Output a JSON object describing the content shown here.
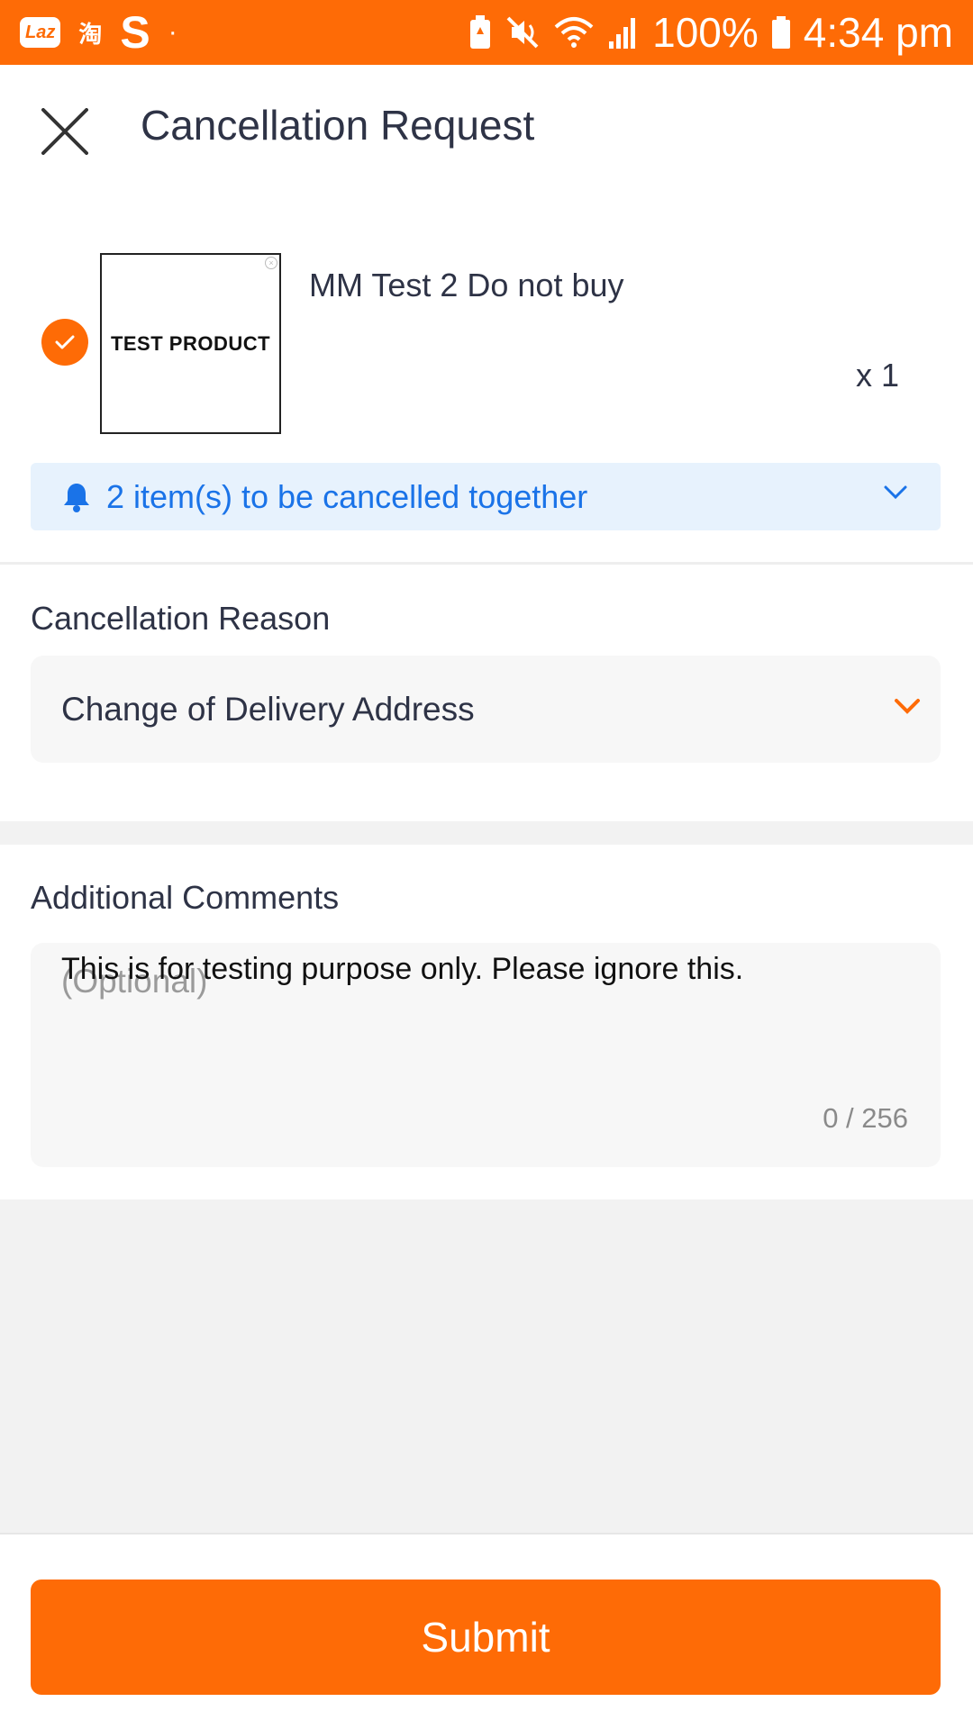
{
  "status_bar": {
    "left_icons": [
      "lazada-icon",
      "taobao-icon",
      "shopee-icon",
      "dot-icon"
    ],
    "lazada_label": "Laz",
    "taobao_label": "淘",
    "shopee_label": "S",
    "dot_label": "·",
    "battery_percent": "100%",
    "time": "4:34 pm"
  },
  "header": {
    "title": "Cancellation Request"
  },
  "product": {
    "image_text": "TEST PRODUCT",
    "name": "MM Test 2 Do not buy",
    "quantity": "x 1",
    "selected": true
  },
  "notice": {
    "text": "2 item(s) to be cancelled together"
  },
  "reason": {
    "label": "Cancellation Reason",
    "value": "Change of Delivery Address"
  },
  "comments": {
    "label": "Additional Comments",
    "placeholder": "(Optional)",
    "value": "This is for testing purpose only. Please ignore this.",
    "counter": "0 / 256"
  },
  "footer": {
    "submit_label": "Submit"
  },
  "colors": {
    "accent": "#fe6b06",
    "notice_bg": "#e7f2fd",
    "notice_text": "#1a73e8"
  }
}
